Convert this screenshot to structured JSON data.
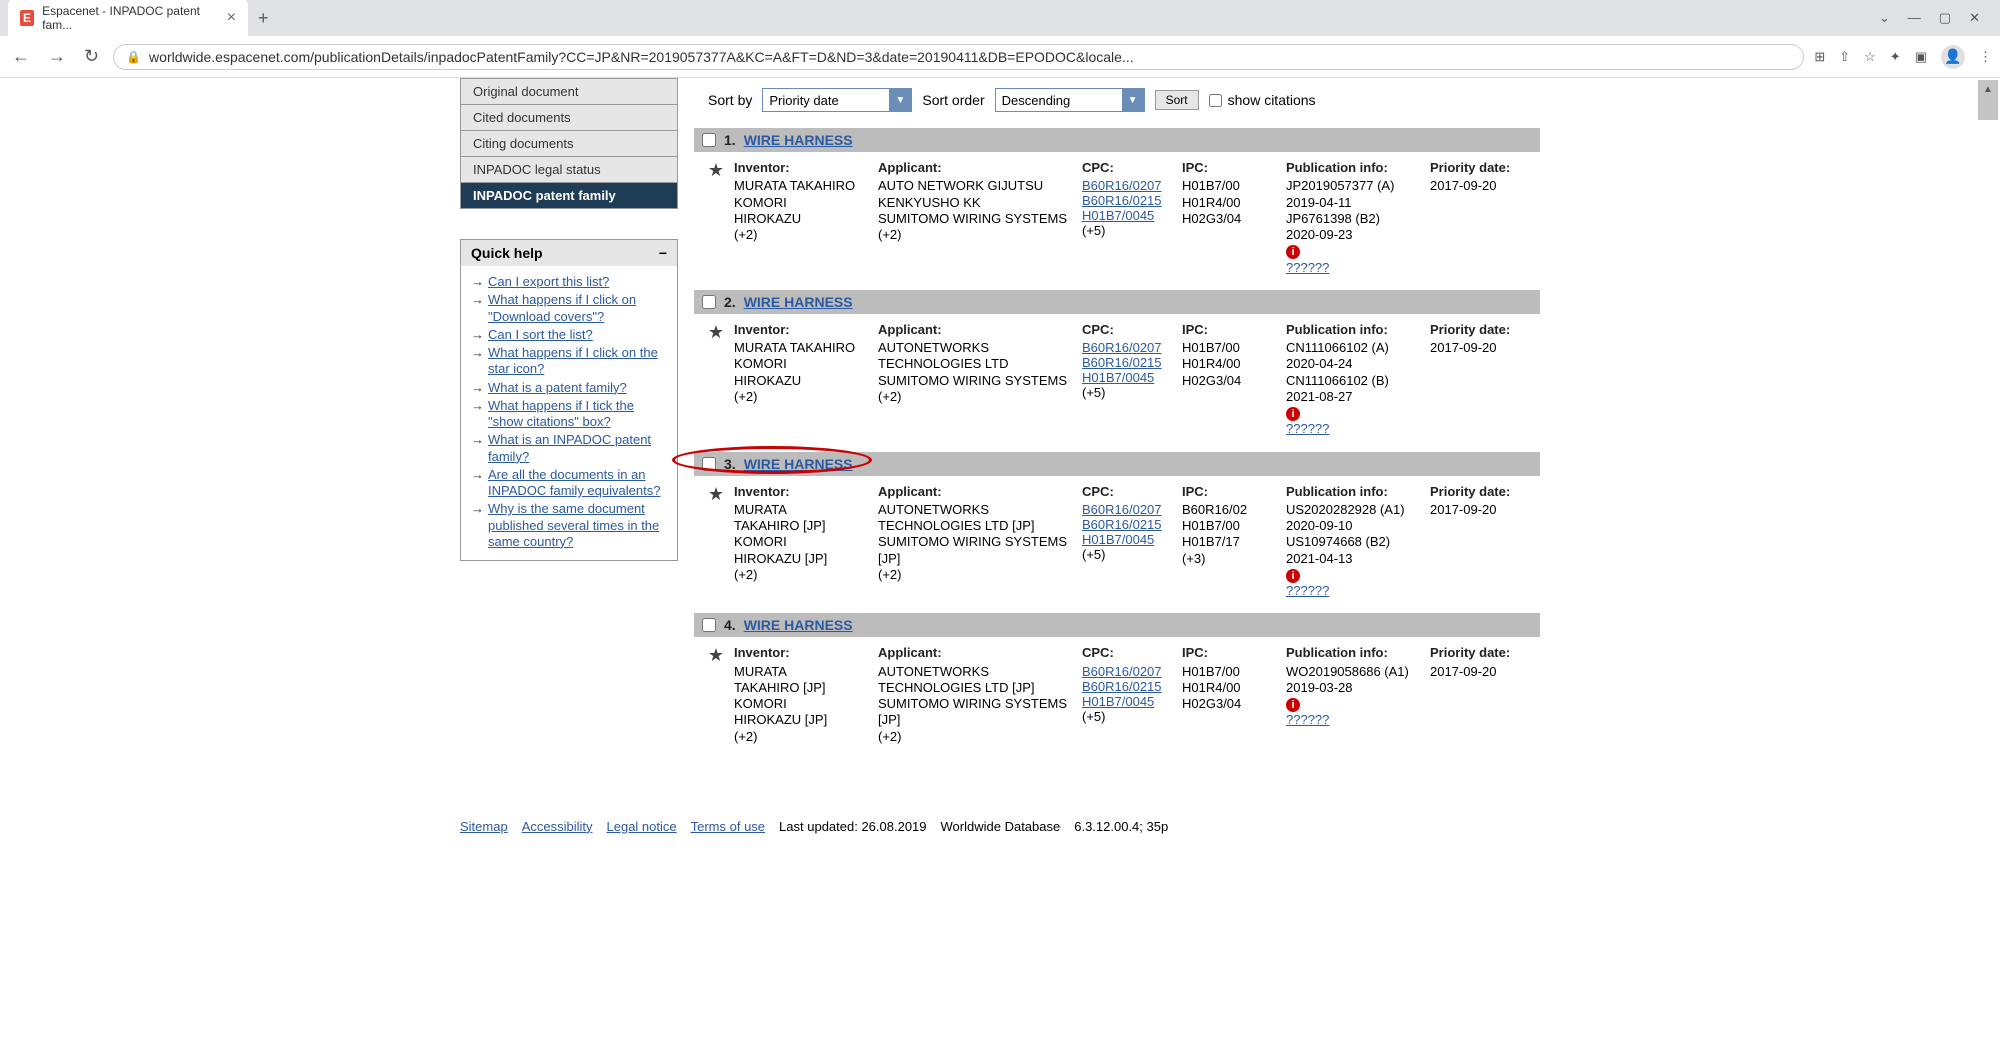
{
  "browser": {
    "tab_title": "Espacenet - INPADOC patent fam...",
    "url": "worldwide.espacenet.com/publicationDetails/inpadocPatentFamily?CC=JP&NR=2019057377A&KC=A&FT=D&ND=3&date=20190411&DB=EPODOC&locale..."
  },
  "sidebar": {
    "items": [
      {
        "label": "Original document"
      },
      {
        "label": "Cited documents"
      },
      {
        "label": "Citing documents"
      },
      {
        "label": "INPADOC legal status"
      },
      {
        "label": "INPADOC patent family",
        "active": true
      }
    ]
  },
  "quickhelp": {
    "title": "Quick help",
    "toggle": "−",
    "items": [
      "Can I export this list?",
      "What happens if I click on \"Download covers\"?",
      "Can I sort the list?",
      "What happens if I click on the star icon?",
      "What is a patent family?",
      "What happens if I tick the \"show citations\" box?",
      "What is an INPADOC patent family?",
      "Are all the documents in an INPADOC family equivalents?",
      "Why is the same document published several times in the same country?"
    ]
  },
  "controls": {
    "sort_by_label": "Sort by",
    "sort_by_value": "Priority date",
    "sort_order_label": "Sort order",
    "sort_order_value": "Descending",
    "sort_button": "Sort",
    "show_citations_label": "show citations"
  },
  "headers": {
    "inventor": "Inventor:",
    "applicant": "Applicant:",
    "cpc": "CPC:",
    "ipc": "IPC:",
    "pub": "Publication info:",
    "priority": "Priority date:"
  },
  "results": [
    {
      "num": "1.",
      "title": "WIRE HARNESS",
      "inventor": [
        "MURATA TAKAHIRO",
        "KOMORI",
        "HIROKAZU",
        "(+2)"
      ],
      "applicant": [
        "AUTO NETWORK GIJUTSU",
        "KENKYUSHO KK",
        "SUMITOMO WIRING SYSTEMS",
        "(+2)"
      ],
      "cpc_links": [
        "B60R16/0207",
        "B60R16/0215",
        "H01B7/0045"
      ],
      "cpc_more": "(+5)",
      "ipc": [
        "H01B7/00",
        "H01R4/00",
        "H02G3/04"
      ],
      "pub": [
        "JP2019057377 (A)",
        "2019-04-11",
        "JP6761398 (B2)",
        "2020-09-23"
      ],
      "pub_link": "??????",
      "priority": "2017-09-20"
    },
    {
      "num": "2.",
      "title": "WIRE HARNESS",
      "inventor": [
        "MURATA TAKAHIRO",
        "KOMORI",
        "HIROKAZU",
        "(+2)"
      ],
      "applicant": [
        "AUTONETWORKS",
        "TECHNOLOGIES LTD",
        "SUMITOMO WIRING SYSTEMS",
        "(+2)"
      ],
      "cpc_links": [
        "B60R16/0207",
        "B60R16/0215",
        "H01B7/0045"
      ],
      "cpc_more": "(+5)",
      "ipc": [
        "H01B7/00",
        "H01R4/00",
        "H02G3/04"
      ],
      "pub": [
        "CN111066102 (A)",
        "2020-04-24",
        "CN111066102 (B)",
        "2021-08-27"
      ],
      "pub_link": "??????",
      "priority": "2017-09-20"
    },
    {
      "num": "3.",
      "title": "WIRE HARNESS",
      "highlighted": true,
      "inventor": [
        "MURATA",
        "TAKAHIRO [JP]",
        "KOMORI",
        "HIROKAZU [JP]",
        "(+2)"
      ],
      "applicant": [
        "AUTONETWORKS",
        "TECHNOLOGIES LTD [JP]",
        "SUMITOMO WIRING SYSTEMS",
        "[JP]",
        "(+2)"
      ],
      "cpc_links": [
        "B60R16/0207",
        "B60R16/0215",
        "H01B7/0045"
      ],
      "cpc_more": "(+5)",
      "ipc": [
        "B60R16/02",
        "H01B7/00",
        "H01B7/17",
        "(+3)"
      ],
      "pub": [
        "US2020282928 (A1)",
        "2020-09-10",
        "US10974668 (B2)",
        "2021-04-13"
      ],
      "pub_link": "??????",
      "priority": "2017-09-20"
    },
    {
      "num": "4.",
      "title": "WIRE HARNESS",
      "inventor": [
        "MURATA",
        "TAKAHIRO [JP]",
        "KOMORI",
        "HIROKAZU [JP]",
        "(+2)"
      ],
      "applicant": [
        "AUTONETWORKS",
        "TECHNOLOGIES LTD [JP]",
        "SUMITOMO WIRING SYSTEMS",
        "[JP]",
        "(+2)"
      ],
      "cpc_links": [
        "B60R16/0207",
        "B60R16/0215",
        "H01B7/0045"
      ],
      "cpc_more": "(+5)",
      "ipc": [
        "H01B7/00",
        "H01R4/00",
        "H02G3/04"
      ],
      "pub": [
        "WO2019058686 (A1)",
        "2019-03-28"
      ],
      "pub_link": "??????",
      "priority": "2017-09-20"
    }
  ],
  "footer": {
    "links": [
      "Sitemap",
      "Accessibility",
      "Legal notice",
      "Terms of use"
    ],
    "updated": "Last updated: 26.08.2019",
    "db": "Worldwide Database",
    "version": "6.3.12.00.4; 35p"
  }
}
